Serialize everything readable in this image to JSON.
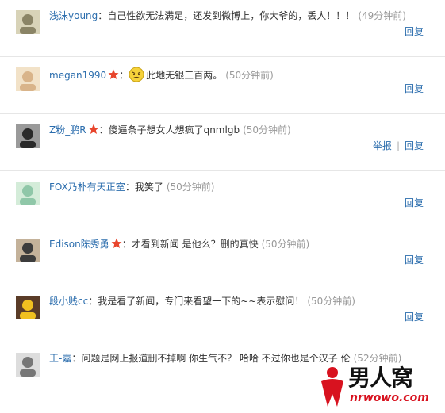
{
  "comments": [
    {
      "author": "浅沫young",
      "badge": false,
      "colon": "：",
      "text": "自己性欲无法满足，还发到微博上，你大爷的，丢人！！！",
      "emoji": "",
      "time": "(49分钟前)",
      "actions": [
        "回复"
      ]
    },
    {
      "author": "megan1990",
      "badge": true,
      "colon": "：",
      "text": "此地无银三百两。",
      "emoji": "angry-face-emoji",
      "time": "(50分钟前)",
      "actions": [
        "回复"
      ]
    },
    {
      "author": "Z粉_鹏R",
      "badge": true,
      "colon": "：",
      "text": "傻逼条子想女人想疯了qnmlgb",
      "emoji": "",
      "time": "(50分钟前)",
      "actions": [
        "举报",
        "回复"
      ]
    },
    {
      "author": "FOX乃朴有天正室",
      "badge": false,
      "colon": "：",
      "text": "我笑了",
      "emoji": "",
      "time": "(50分钟前)",
      "actions": [
        "回复"
      ]
    },
    {
      "author": "Edison陈秀勇",
      "badge": true,
      "colon": "：",
      "text": "才看到新闻 是他么？删的真快",
      "emoji": "",
      "time": "(50分钟前)",
      "actions": [
        "回复"
      ]
    },
    {
      "author": "段小贱cc",
      "badge": false,
      "colon": "：",
      "text": "我是看了新闻，专门来看望一下的~~表示慰问！",
      "emoji": "",
      "time": "(50分钟前)",
      "actions": [
        "回复"
      ]
    },
    {
      "author": "王-嘉",
      "badge": false,
      "colon": "：",
      "text": "问题是网上报道删不掉啊 你生气不？ 哈哈 不过你也是个汉子 伦",
      "emoji": "",
      "time": "(52分钟前)",
      "actions": []
    }
  ],
  "watermark": {
    "title": "男人窝",
    "url": "nrwowo.com"
  },
  "colors": {
    "link": "#2b6dad",
    "time": "#999999",
    "badge": "#e8452c",
    "divider": "#e6e6e6"
  }
}
